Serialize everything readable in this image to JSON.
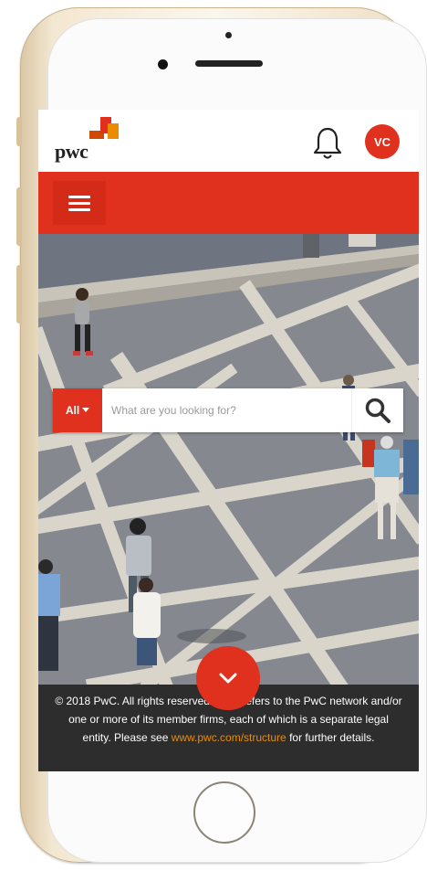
{
  "header": {
    "logo_text": "pwc",
    "avatar_initials": "VC"
  },
  "search": {
    "filter_label": "All",
    "placeholder": "What are you looking for?"
  },
  "footer": {
    "text_before_link": "© 2018 PwC. All rights reserved. PwC refers to the PwC network and/or one or more of its member firms, each of which is a separate legal entity. Please see ",
    "link_text": "www.pwc.com/structure",
    "text_after_link": " for further details."
  },
  "colors": {
    "brand_red": "#e0301e",
    "brand_orange": "#eb8c00",
    "footer_bg": "#2d2d2d"
  },
  "icons": [
    "bell-icon",
    "hamburger-menu-icon",
    "search-icon",
    "chevron-down-icon",
    "caret-down-icon"
  ]
}
